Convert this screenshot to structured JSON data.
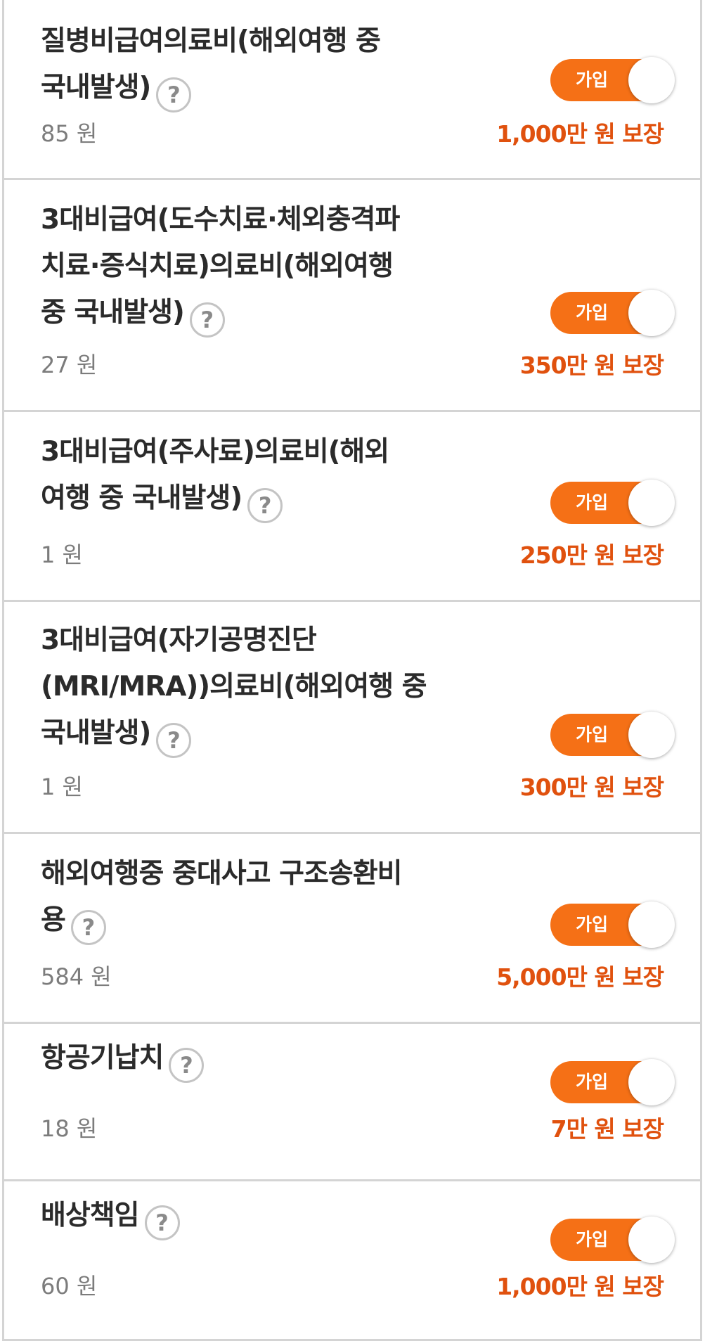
{
  "items": [
    {
      "title": "질병비급여의료비(해외여행 중\n국내발생)",
      "price": "85 원",
      "toggle_label": "가입",
      "toggle_on": true,
      "coverage": "1,000만 원 보장"
    },
    {
      "title": "3대비급여(도수치료·체외충격파\n치료·증식치료)의료비(해외여행\n중 국내발생)",
      "price": "27 원",
      "toggle_label": "가입",
      "toggle_on": true,
      "coverage": "350만 원 보장"
    },
    {
      "title": "3대비급여(주사료)의료비(해외\n여행 중 국내발생)",
      "price": "1 원",
      "toggle_label": "가입",
      "toggle_on": true,
      "coverage": "250만 원 보장"
    },
    {
      "title": "3대비급여(자기공명진단\n(MRI/MRA))의료비(해외여행 중\n국내발생)",
      "price": "1 원",
      "toggle_label": "가입",
      "toggle_on": true,
      "coverage": "300만 원 보장"
    },
    {
      "title": "해외여행중 중대사고 구조송환비\n용",
      "price": "584 원",
      "toggle_label": "가입",
      "toggle_on": true,
      "coverage": "5,000만 원 보장"
    },
    {
      "title": "항공기납치",
      "price": "18 원",
      "toggle_label": "가입",
      "toggle_on": true,
      "coverage": "7만 원 보장"
    },
    {
      "title": "배상책임",
      "price": "60 원",
      "toggle_label": "가입",
      "toggle_on": true,
      "coverage": "1,000만 원 보장"
    }
  ],
  "help_icon_glyph": "?",
  "colors": {
    "toggle_on": "#f57016",
    "coverage_text": "#e0510e",
    "divider": "#d4d4d4"
  },
  "icons": [
    "question-help-icon"
  ]
}
